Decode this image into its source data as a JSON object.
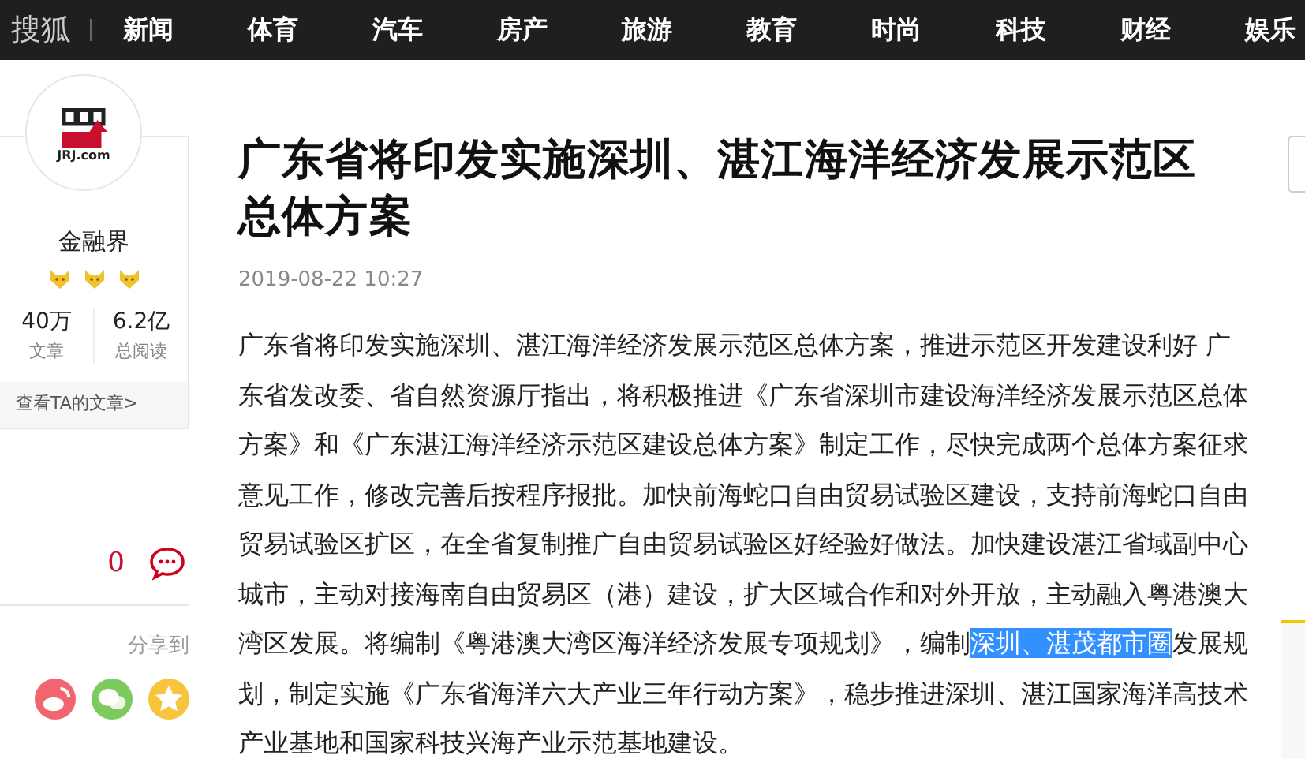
{
  "nav": {
    "logo": "搜狐",
    "items": [
      "新闻",
      "体育",
      "汽车",
      "房产",
      "旅游",
      "教育",
      "时尚",
      "科技",
      "财经",
      "娱乐"
    ]
  },
  "author": {
    "name": "金融界",
    "badges": [
      {
        "kind": "fox"
      },
      {
        "kind": "fox"
      },
      {
        "kind": "fox"
      }
    ],
    "logo_text": "JRJ.com",
    "stats": [
      {
        "value": "40万",
        "label": "文章"
      },
      {
        "value": "6.2亿",
        "label": "总阅读"
      }
    ],
    "link": "查看TA的文章>"
  },
  "comments": {
    "count": "0"
  },
  "share": {
    "label": "分享到",
    "targets": [
      {
        "kind": "weibo",
        "color": "#f0656f"
      },
      {
        "kind": "wechat",
        "color": "#7dcb5f"
      },
      {
        "kind": "qzone",
        "color": "#f8c43d"
      }
    ]
  },
  "article": {
    "title": "广东省将印发实施深圳、湛江海洋经济发展示范区总体方案",
    "date": "2019-08-22 10:27",
    "body": {
      "before": "广东省将印发实施深圳、湛江海洋经济发展示范区总体方案，推进示范区开发建设利好 广东省发改委、省自然资源厅指出，将积极推进《广东省深圳市建设海洋经济发展示范区总体方案》和《广东湛江海洋经济示范区建设总体方案》制定工作，尽快完成两个总体方案征求意见工作，修改完善后按程序报批。加快前海蛇口自由贸易试验区建设，支持前海蛇口自由贸易试验区扩区，在全省复制推广自由贸易试验区好经验好做法。加快建设湛江省域副中心城市，主动对接海南自由贸易区（港）建设，扩大区域合作和对外开放，主动融入粤港澳大湾区发展。将编制《粤港澳大湾区海洋经济发展专项规划》，编制",
      "selected": "深圳、湛茂都市圈",
      "after": "发展规划，制定实施《广东省海洋六大产业三年行动方案》，稳步推进深圳、湛江国家海洋高技术产业基地和国家科技兴海产业示范基地建设。"
    }
  }
}
